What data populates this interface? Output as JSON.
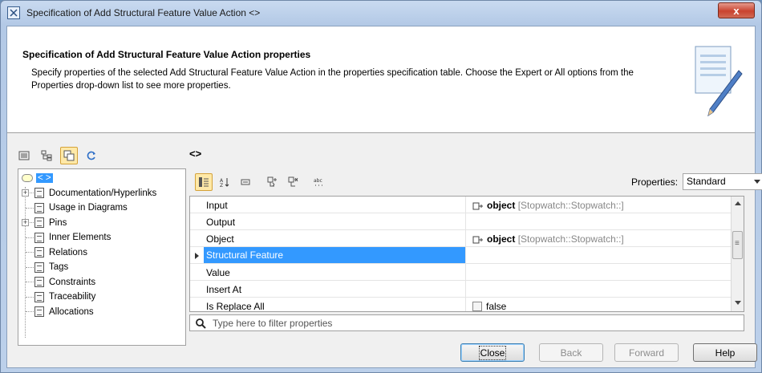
{
  "window": {
    "title": "Specification of Add Structural Feature Value Action <>",
    "close_glyph": "x"
  },
  "header": {
    "title": "Specification of Add Structural Feature Value Action properties",
    "description": "Specify properties of the selected Add Structural Feature Value Action in the properties specification table. Choose the Expert or All options from the Properties drop-down list to see more properties."
  },
  "element_title": "<>",
  "tree": {
    "root_label": "< >",
    "items": [
      {
        "label": "Documentation/Hyperlinks",
        "expandable": true
      },
      {
        "label": "Usage in Diagrams",
        "expandable": false
      },
      {
        "label": "Pins",
        "expandable": true
      },
      {
        "label": "Inner Elements",
        "expandable": false
      },
      {
        "label": "Relations",
        "expandable": false
      },
      {
        "label": "Tags",
        "expandable": false
      },
      {
        "label": "Constraints",
        "expandable": false
      },
      {
        "label": "Traceability",
        "expandable": false
      },
      {
        "label": "Allocations",
        "expandable": false
      }
    ]
  },
  "properties": {
    "mode_label": "Properties:",
    "mode_value": "Standard",
    "rows": [
      {
        "name": "Input",
        "value": "object",
        "value_type": "[Stopwatch::Stopwatch::]"
      },
      {
        "name": "Output",
        "value": "",
        "value_type": ""
      },
      {
        "name": "Object",
        "value": "object",
        "value_type": "[Stopwatch::Stopwatch::]"
      },
      {
        "name": "Structural Feature",
        "value": "",
        "value_type": "",
        "selected": true
      },
      {
        "name": "Value",
        "value": "",
        "value_type": ""
      },
      {
        "name": "Insert At",
        "value": "",
        "value_type": ""
      },
      {
        "name": "Is Replace All",
        "value": "false",
        "value_type": "",
        "checkbox": true
      }
    ],
    "filter_placeholder": "Type here to filter properties"
  },
  "buttons": {
    "close": "Close",
    "back": "Back",
    "forward": "Forward",
    "help": "Help"
  },
  "colors": {
    "selection": "#3399ff",
    "accent_toggle": "#ffe9a8"
  }
}
